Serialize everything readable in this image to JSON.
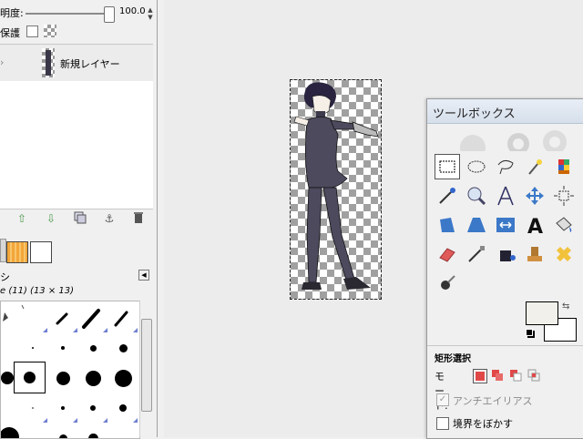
{
  "layers_panel": {
    "opacity_label": "明度:",
    "opacity_value": "100.0",
    "lock_label": "保護",
    "layer_name": "新規レイヤー"
  },
  "brushes_panel": {
    "title": "シ",
    "brush_info": "e (11) (13 × 13)"
  },
  "toolbox": {
    "title": "ツールボックス",
    "tool_options_title": "矩形選択",
    "mode_label": "モード:",
    "antialias_label": "アンチエイリアス",
    "feather_label": "境界をぼかす"
  },
  "colors": {
    "foreground": "#f1f0ea",
    "background": "#ffffff",
    "gradient_orange": "#f3a63a"
  },
  "icons": [
    "anchor-icon",
    "trash-icon",
    "rect-select-icon",
    "ellipse-select-icon",
    "lasso-icon",
    "fuzzy-select-icon",
    "color-select-icon",
    "scissors-icon",
    "zoom-icon",
    "measure-icon",
    "move-icon",
    "align-icon",
    "crop-icon",
    "rotate-icon",
    "scale-icon",
    "shear-icon",
    "perspective-icon",
    "flip-icon",
    "text-icon",
    "bucket-fill-icon",
    "blend-icon",
    "pencil-icon",
    "paintbrush-icon",
    "eraser-icon",
    "airbrush-icon",
    "ink-icon",
    "clone-icon",
    "heal-icon",
    "smudge-icon",
    "dodge-icon"
  ]
}
